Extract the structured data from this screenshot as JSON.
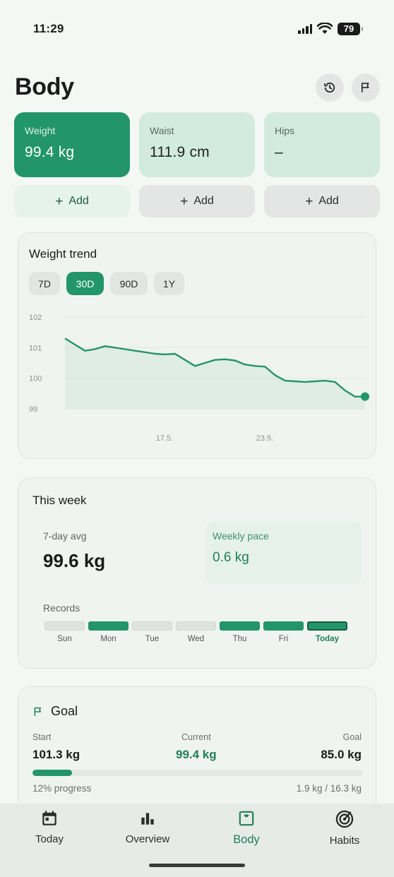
{
  "status_bar": {
    "time": "11:29",
    "battery": "79"
  },
  "header": {
    "title": "Body",
    "history_icon": "history-icon",
    "goal_icon": "flag-icon"
  },
  "metrics": [
    {
      "label": "Weight",
      "value": "99.4 kg",
      "selected": true
    },
    {
      "label": "Waist",
      "value": "111.9 cm",
      "selected": false
    },
    {
      "label": "Hips",
      "value": "–",
      "selected": false
    }
  ],
  "add_label": "Add",
  "trend": {
    "title": "Weight trend",
    "ranges": [
      "7D",
      "30D",
      "90D",
      "1Y"
    ],
    "selected_range": "30D",
    "chart_data": {
      "type": "line",
      "ylim": [
        99,
        102
      ],
      "yticks": [
        "102",
        "101",
        "100",
        "99"
      ],
      "xticks": [
        "17.5.",
        "23.5."
      ],
      "grid": true,
      "series": [
        {
          "values": [
            101.3,
            101.1,
            100.9,
            100.95,
            101.05,
            101.0,
            100.95,
            100.9,
            100.85,
            100.8,
            100.78,
            100.8,
            100.6,
            100.4,
            100.5,
            100.6,
            100.62,
            100.58,
            100.45,
            100.4,
            100.38,
            100.1,
            99.92,
            99.9,
            99.88,
            99.9,
            99.92,
            99.88,
            99.6,
            99.4,
            99.4
          ]
        }
      ]
    }
  },
  "week": {
    "title": "This week",
    "avg_label": "7-day avg",
    "avg_value": "99.6 kg",
    "pace_label": "Weekly pace",
    "pace_value": "0.6 kg",
    "records_label": "Records",
    "days": [
      {
        "label": "Sun",
        "recorded": false
      },
      {
        "label": "Mon",
        "recorded": true
      },
      {
        "label": "Tue",
        "recorded": false
      },
      {
        "label": "Wed",
        "recorded": false
      },
      {
        "label": "Thu",
        "recorded": true
      },
      {
        "label": "Fri",
        "recorded": true
      },
      {
        "label": "Today",
        "recorded": true
      }
    ]
  },
  "goal": {
    "title": "Goal",
    "start_label": "Start",
    "start_value": "101.3 kg",
    "current_label": "Current",
    "current_value": "99.4 kg",
    "goal_label": "Goal",
    "goal_value": "85.0 kg",
    "progress_fraction": 0.12,
    "progress_label": "12% progress",
    "progress_amount": "1.9 kg / 16.3 kg"
  },
  "nav": [
    {
      "label": "Today",
      "icon": "calendar-icon"
    },
    {
      "label": "Overview",
      "icon": "bar-chart-icon"
    },
    {
      "label": "Body",
      "icon": "scale-icon",
      "selected": true
    },
    {
      "label": "Habits",
      "icon": "target-icon"
    }
  ],
  "colors": {
    "accent": "#23956a",
    "accent_dark": "#1f7f58",
    "background": "#f4f8f5"
  }
}
